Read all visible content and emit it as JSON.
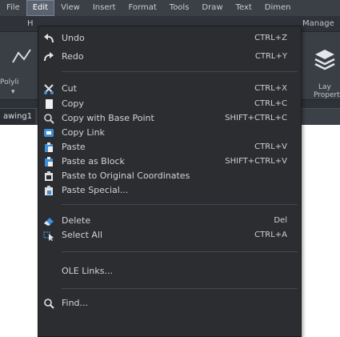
{
  "menubar": {
    "items": [
      "File",
      "Edit",
      "View",
      "Insert",
      "Format",
      "Tools",
      "Draw",
      "Text",
      "Dimen"
    ]
  },
  "ribbon_tabs": {
    "left_fragment": "H",
    "right": "Manage"
  },
  "ribbon": {
    "left_label_1": "Polyli",
    "left_label_2": "▾",
    "right_label_1": "Lay",
    "right_label_2": "Propert"
  },
  "doc_tab": {
    "label": "awing1"
  },
  "edit_menu": {
    "undo": {
      "label": "Undo",
      "shortcut": "CTRL+Z"
    },
    "redo": {
      "label": "Redo",
      "shortcut": "CTRL+Y"
    },
    "cut": {
      "label": "Cut",
      "shortcut": "CTRL+X"
    },
    "copy": {
      "label": "Copy",
      "shortcut": "CTRL+C"
    },
    "copy_base": {
      "label": "Copy with Base Point",
      "shortcut": "SHIFT+CTRL+C"
    },
    "copy_link": {
      "label": "Copy Link",
      "shortcut": ""
    },
    "paste": {
      "label": "Paste",
      "shortcut": "CTRL+V"
    },
    "paste_block": {
      "label": "Paste as Block",
      "shortcut": "SHIFT+CTRL+V"
    },
    "paste_orig": {
      "label": "Paste to Original Coordinates",
      "shortcut": ""
    },
    "paste_special": {
      "label": "Paste Special...",
      "shortcut": ""
    },
    "delete": {
      "label": "Delete",
      "shortcut": "Del"
    },
    "select_all": {
      "label": "Select All",
      "shortcut": "CTRL+A"
    },
    "ole_links": {
      "label": "OLE Links...",
      "shortcut": ""
    },
    "find": {
      "label": "Find...",
      "shortcut": ""
    }
  },
  "colors": {
    "menu_bg": "#2b2d31",
    "menubar_bg": "#3b3f46",
    "ribbon_bg": "#3a3e45",
    "accent_blue": "#3f8fd8"
  },
  "icons": {
    "undo": "undo-arrow-icon",
    "redo": "redo-arrow-icon",
    "cut": "scissors-icon",
    "copy": "copy-page-icon",
    "copy_base": "copy-base-point-icon",
    "copy_link": "copy-link-icon",
    "paste": "clipboard-icon",
    "paste_block": "paste-block-icon",
    "paste_orig": "paste-original-icon",
    "paste_special": "paste-special-icon",
    "delete": "eraser-icon",
    "select_all": "cursor-select-icon",
    "find": "magnifier-icon"
  }
}
